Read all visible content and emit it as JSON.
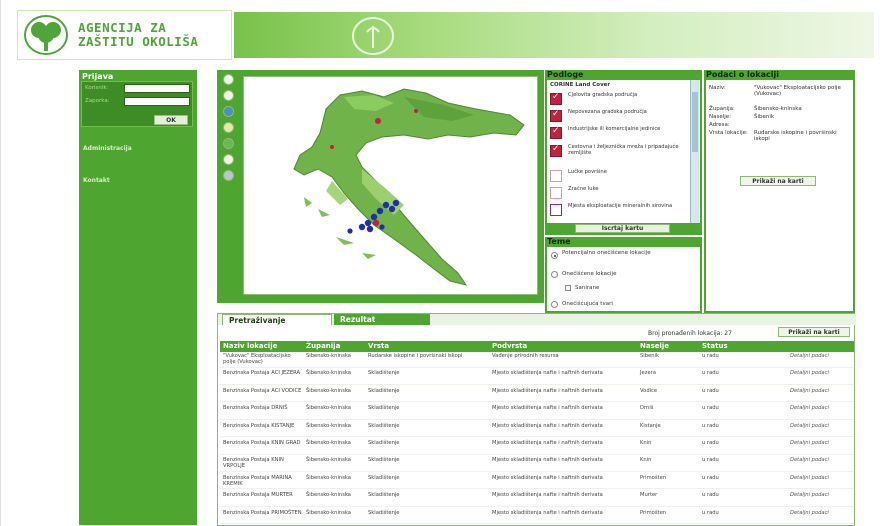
{
  "header": {
    "logo_line1": "AGENCIJA ZA",
    "logo_line2": "ZAŠTITU OKOLIŠA"
  },
  "login": {
    "title": "Prijava",
    "username_label": "Korisnik:",
    "password_label": "Zaporka:",
    "ok_label": "OK"
  },
  "sidebar": {
    "links": [
      "Administracija",
      "Kontakt"
    ]
  },
  "layers": {
    "title": "Podloge",
    "group_label": "CORINE Land Cover",
    "items": [
      {
        "label": "Cjelovita gradska područja",
        "checked": true
      },
      {
        "label": "Nepovezana gradska područja",
        "checked": true
      },
      {
        "label": "Industrijske ili komercijalne jedinice",
        "checked": true
      },
      {
        "label": "Cestovna i željeznička mreža i pripadajuće zemljište",
        "checked": true
      },
      {
        "label": "Lučke površine",
        "checked": false
      },
      {
        "label": "Zračne luke",
        "checked": false
      },
      {
        "label": "Mjesta eksploatacije mineralnih sirovina",
        "checked": false
      }
    ],
    "draw_button": "Iscrtaj kartu"
  },
  "themes": {
    "title": "Teme",
    "option1": "Potencijalno onečišćene lokacije",
    "option2": "Onečišćene lokacije",
    "suboption": "Sanirane",
    "option3": "Onečišćujuća tvari"
  },
  "details": {
    "title": "Podaci o lokaciji",
    "fields": [
      {
        "label": "Naziv:",
        "value": "\"Vukovac\" Eksploatacijsko polje (Vukovac)"
      },
      {
        "label": "Županija:",
        "value": "Šibensko-kninska"
      },
      {
        "label": "Naselje:",
        "value": "Šibenik"
      },
      {
        "label": "Adresa:",
        "value": ""
      },
      {
        "label": "Vrsta lokacije:",
        "value": "Rudarske iskopine i površinski iskopi"
      }
    ],
    "show_button": "Prikaži na karti"
  },
  "results": {
    "tab_search": "Pretraživanje",
    "tab_result": "Rezultat",
    "count_text": "Broj pronađenih lokacija: 27",
    "show_all_button": "Prikaži na karti",
    "columns": [
      "Naziv lokacije",
      "Županija",
      "Vrsta",
      "Podvrsta",
      "Naselje",
      "Status",
      ""
    ],
    "rows": [
      [
        "\"Vukovac\" Eksploatacijsko polje (Vukovac)",
        "Šibensko-kninska",
        "Rudarske iskopine i površinski iskopi",
        "Vađenje prirodnih resursa",
        "Šibenik",
        "u radu",
        "Detaljni podaci"
      ],
      [
        "Benzinska Postaja ACI JEZERA",
        "Šibensko-kninska",
        "Skladištenje",
        "Mjesto skladištenja nafte i naftnih derivata",
        "Jezera",
        "u radu",
        "Detaljni podaci"
      ],
      [
        "Benzinska Postaja ACI VODICE",
        "Šibensko-kninska",
        "Skladištenje",
        "Mjesto skladištenja nafte i naftnih derivata",
        "Vodice",
        "u radu",
        "Detaljni podaci"
      ],
      [
        "Benzinska Postaja DRNIŠ",
        "Šibensko-kninska",
        "Skladištenje",
        "Mjesto skladištenja nafte i naftnih derivata",
        "Drniš",
        "u radu",
        "Detaljni podaci"
      ],
      [
        "Benzinska Postaja KISTANJE",
        "Šibensko-kninska",
        "Skladištenje",
        "Mjesto skladištenja nafte i naftnih derivata",
        "Kistanje",
        "u radu",
        "Detaljni podaci"
      ],
      [
        "Benzinska Postaja KNIN GRAD",
        "Šibensko-kninska",
        "Skladištenje",
        "Mjesto skladištenja nafte i naftnih derivata",
        "Knin",
        "u radu",
        "Detaljni podaci"
      ],
      [
        "Benzinska Postaja KNIN VRPOLJE",
        "Šibensko-kninska",
        "Skladištenje",
        "Mjesto skladištenja nafte i naftnih derivata",
        "Knin",
        "u radu",
        "Detaljni podaci"
      ],
      [
        "Benzinska Postaja MARINA KREMIK",
        "Šibensko-kninska",
        "Skladištenje",
        "Mjesto skladištenja nafte i naftnih derivata",
        "Primošten",
        "u radu",
        "Detaljni podaci"
      ],
      [
        "Benzinska Postaja MURTER",
        "Šibensko-kninska",
        "Skladištenje",
        "Mjesto skladištenja nafte i naftnih derivata",
        "Murter",
        "u radu",
        "Detaljni podaci"
      ],
      [
        "Benzinska Postaja PRIMOŠTEN",
        "Šibensko-kninska",
        "Skladištenje",
        "Mjesto skladištenja nafte i naftnih derivata",
        "Primošten",
        "u radu",
        "Detaljni podaci"
      ]
    ]
  },
  "colors": {
    "brand_green": "#4ea631",
    "logo_green": "#4fa53a",
    "checked_layer": "#c2223e",
    "map_land": "#6fb34a",
    "marker_blue": "#1f2fa8"
  }
}
